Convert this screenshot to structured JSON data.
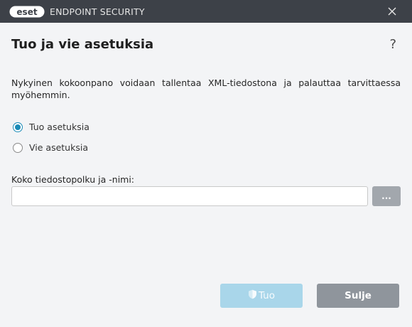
{
  "titlebar": {
    "logo_text": "eset",
    "product_name": "ENDPOINT SECURITY"
  },
  "dialog": {
    "title": "Tuo ja vie asetuksia",
    "help_label": "?",
    "description": "Nykyinen kokoonpano voidaan tallentaa XML-tiedostona ja palauttaa tarvittaessa myöhemmin.",
    "options": [
      {
        "label": "Tuo asetuksia",
        "selected": true
      },
      {
        "label": "Vie asetuksia",
        "selected": false
      }
    ],
    "path_label": "Koko tiedostopolku ja -nimi:",
    "path_value": "",
    "browse_label": "...",
    "import_label": "Tuo",
    "close_label": "Sulje"
  },
  "colors": {
    "titlebar": "#3d4148",
    "accent": "#1b8bb7",
    "import_button": "#a9d6ea",
    "close_button": "#8f959c"
  },
  "icons": {
    "close": "close-icon",
    "shield": "shield-icon"
  }
}
